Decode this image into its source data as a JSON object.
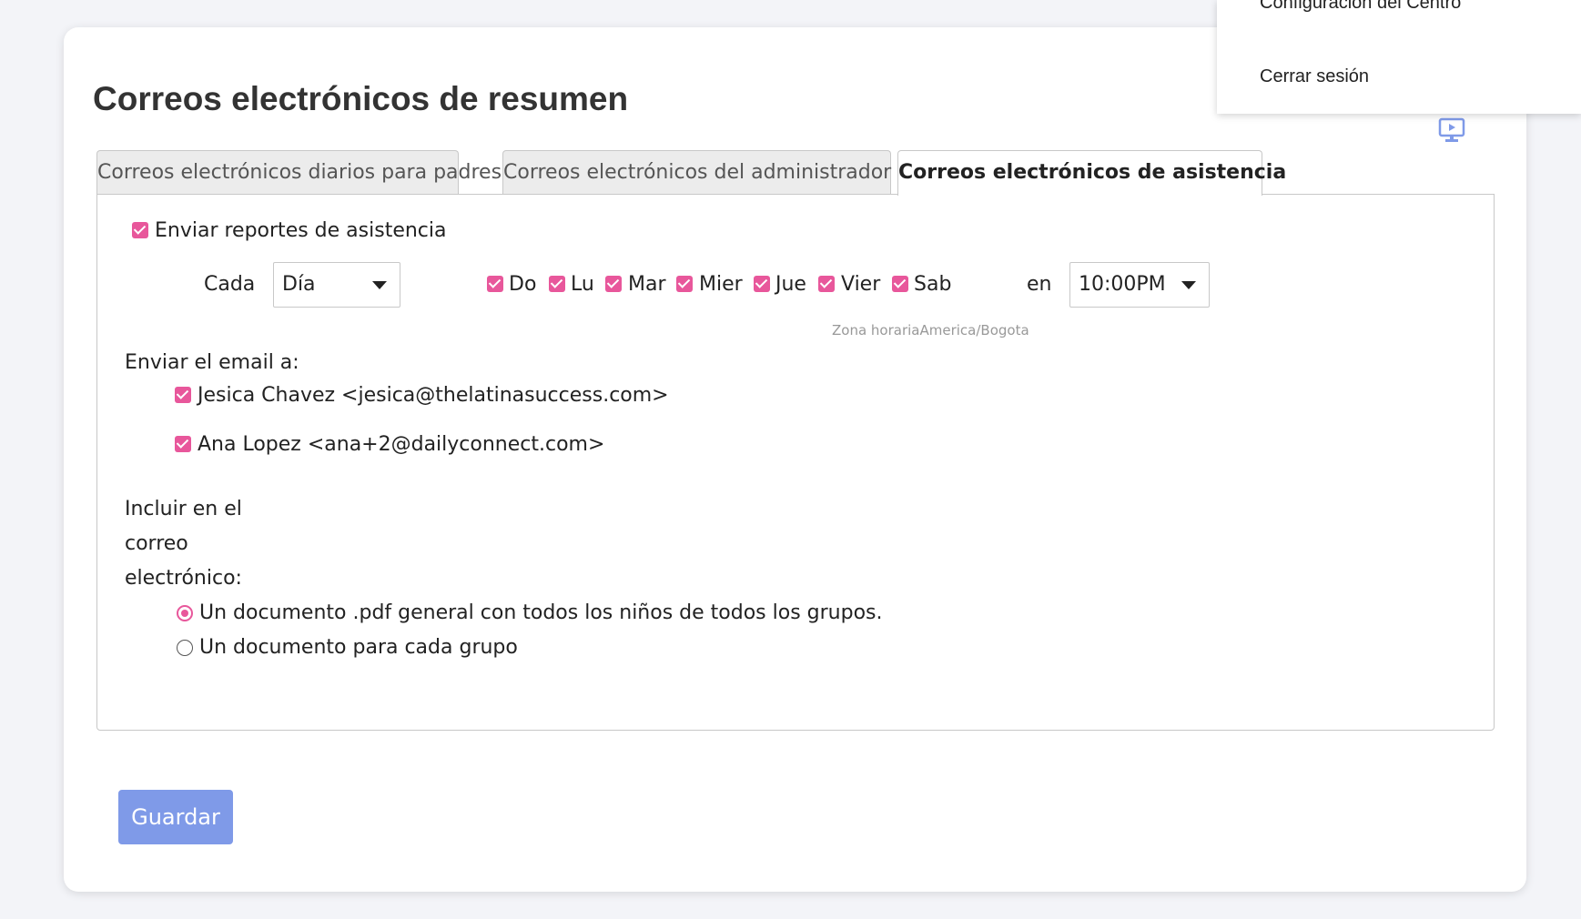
{
  "page": {
    "title": "Correos electrónicos de resumen"
  },
  "tabs": [
    {
      "label": "Correos electrónicos diarios para padres"
    },
    {
      "label": "Correos electrónicos del administrador"
    },
    {
      "label": "Correos electrónicos de asistencia",
      "active": true
    }
  ],
  "attendance": {
    "send_reports": {
      "label": "Enviar reportes de asistencia",
      "checked": true
    },
    "frequency": {
      "label": "Cada",
      "value": "Día"
    },
    "days": [
      {
        "label": "Do",
        "checked": true
      },
      {
        "label": "Lu",
        "checked": true
      },
      {
        "label": "Mar",
        "checked": true
      },
      {
        "label": "Mier",
        "checked": true
      },
      {
        "label": "Jue",
        "checked": true
      },
      {
        "label": "Vier",
        "checked": true
      },
      {
        "label": "Sab",
        "checked": true
      }
    ],
    "time": {
      "label": "en",
      "value": "10:00PM"
    },
    "timezone": "Zona horariaAmerica/Bogota",
    "recipients_label": "Enviar el email a:",
    "recipients": [
      {
        "label": "Jesica Chavez <jesica@thelatinasuccess.com>",
        "checked": true
      },
      {
        "label": "Ana Lopez <ana+2@dailyconnect.com>",
        "checked": true
      }
    ],
    "include_label": [
      "Incluir en el",
      "correo",
      "electrónico:"
    ],
    "include_options": [
      {
        "label": "Un documento .pdf general con todos los niños de todos los grupos.",
        "selected": true
      },
      {
        "label": "Un documento para cada grupo",
        "selected": false
      }
    ]
  },
  "actions": {
    "save_label": "Guardar"
  },
  "user_menu": {
    "items": [
      {
        "label": "Configuración del Centro"
      },
      {
        "label": "Cerrar sesión"
      }
    ]
  },
  "colors": {
    "accent": "#e8579b",
    "button": "#7f9ae8",
    "icon": "#7f9ae8"
  },
  "icons": {
    "monitor": "monitor-play-icon"
  }
}
